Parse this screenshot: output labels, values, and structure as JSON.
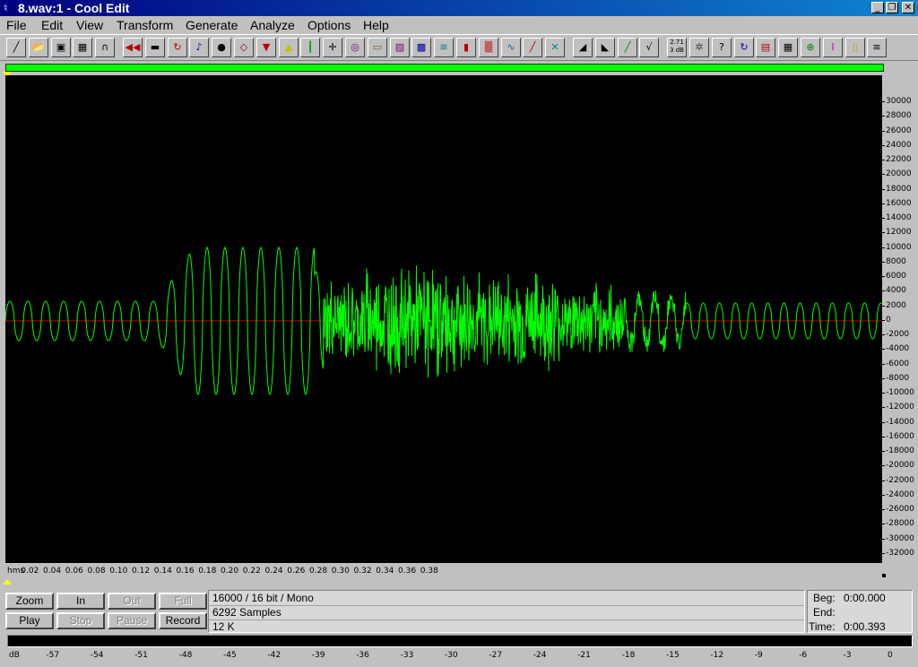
{
  "window": {
    "title": "8.wav:1 - Cool Edit",
    "app_icon": "cool-edit-icon",
    "minimize_label": "_",
    "restore_label": "❐",
    "close_label": "✕"
  },
  "menu": [
    {
      "label": "File"
    },
    {
      "label": "Edit"
    },
    {
      "label": "View"
    },
    {
      "label": "Transform"
    },
    {
      "label": "Generate"
    },
    {
      "label": "Analyze"
    },
    {
      "label": "Options"
    },
    {
      "label": "Help"
    }
  ],
  "toolbar": {
    "buttons": [
      {
        "name": "new-icon",
        "glyph": "╱",
        "color": "#000000"
      },
      {
        "name": "open-icon",
        "glyph": "📂",
        "color": "#c08000"
      },
      {
        "name": "save-icon",
        "glyph": "▣",
        "color": "#000000"
      },
      {
        "name": "cd-icon",
        "glyph": "▦",
        "color": "#000000"
      },
      {
        "name": "headphones-icon",
        "glyph": "∩",
        "color": "#000000"
      },
      {
        "name": "rewind-icon",
        "glyph": "◀◀",
        "color": "#c00000"
      },
      {
        "name": "cut-icon",
        "glyph": "▬",
        "color": "#000000"
      },
      {
        "name": "loop-icon",
        "glyph": "↻",
        "color": "#c00000"
      },
      {
        "name": "note-icon",
        "glyph": "♪",
        "color": "#0000c0"
      },
      {
        "name": "record-dot-icon",
        "glyph": "●",
        "color": "#000000"
      },
      {
        "name": "envelope-icon",
        "glyph": "◇",
        "color": "#800000"
      },
      {
        "name": "marker-down-icon",
        "glyph": "▼",
        "color": "#c00000"
      },
      {
        "name": "amplify-icon",
        "glyph": "▲",
        "color": "#c0c000"
      },
      {
        "name": "waveform-icon",
        "glyph": "┃",
        "color": "#00a000"
      },
      {
        "name": "compass-icon",
        "glyph": "✛",
        "color": "#000000"
      },
      {
        "name": "signal-icon",
        "glyph": "◎",
        "color": "#800080"
      },
      {
        "name": "cassette-icon",
        "glyph": "▭",
        "color": "#806000"
      },
      {
        "name": "filter-icon",
        "glyph": "▨",
        "color": "#800080"
      },
      {
        "name": "spectrum-icon",
        "glyph": "▩",
        "color": "#0000a0"
      },
      {
        "name": "wave-multi-icon",
        "glyph": "≋",
        "color": "#008080"
      },
      {
        "name": "bars-icon",
        "glyph": "▮",
        "color": "#c00000"
      },
      {
        "name": "noise-icon",
        "glyph": "▒",
        "color": "#c00000"
      },
      {
        "name": "wave-blue-icon",
        "glyph": "∿",
        "color": "#0060c0"
      },
      {
        "name": "slope-icon",
        "glyph": "╱",
        "color": "#c00000"
      },
      {
        "name": "crossfade-icon",
        "glyph": "✕",
        "color": "#008080"
      },
      {
        "name": "fade-in-icon",
        "glyph": "◢",
        "color": "#000000"
      },
      {
        "name": "fade-out-icon",
        "glyph": "◣",
        "color": "#000000"
      },
      {
        "name": "trend-icon",
        "glyph": "╱",
        "color": "#008000"
      },
      {
        "name": "graph-icon",
        "glyph": "√",
        "color": "#000000"
      },
      {
        "name": "db-icon",
        "glyph": "dB",
        "color": "#000000"
      },
      {
        "name": "gear-icon",
        "glyph": "✲",
        "color": "#404040"
      },
      {
        "name": "help-icon",
        "glyph": "?",
        "color": "#000000"
      },
      {
        "name": "refresh-icon",
        "glyph": "↻",
        "color": "#0000c0"
      },
      {
        "name": "level-meter-icon",
        "glyph": "▤",
        "color": "#c00000"
      },
      {
        "name": "properties-icon",
        "glyph": "▦",
        "color": "#000000"
      },
      {
        "name": "zoom-analyze-icon",
        "glyph": "⊕",
        "color": "#008000"
      },
      {
        "name": "cursor-icon",
        "glyph": "I",
        "color": "#c000c0"
      },
      {
        "name": "notepad-icon",
        "glyph": "▯",
        "color": "#c0a000"
      },
      {
        "name": "info-icon",
        "glyph": "≡",
        "color": "#000000"
      }
    ],
    "db_label": "2.71 3 dB"
  },
  "waveform": {
    "wave_color": "#00ff00",
    "centerline_color": "#c00000",
    "background": "#000000",
    "y_axis_labels": [
      "30000",
      "28000",
      "26000",
      "24000",
      "22000",
      "20000",
      "18000",
      "16000",
      "14000",
      "12000",
      "10000",
      "8000",
      "6000",
      "4000",
      "2000",
      "0",
      "-2000",
      "-4000",
      "-6000",
      "-8000",
      "-10000",
      "-12000",
      "-14000",
      "-16000",
      "-18000",
      "-20000",
      "-22000",
      "-24000",
      "-26000",
      "-28000",
      "-30000",
      "-32000"
    ],
    "x_axis_labels": [
      "hms",
      "0.02",
      "0.04",
      "0.06",
      "0.08",
      "0.10",
      "0.12",
      "0.14",
      "0.16",
      "0.18",
      "0.20",
      "0.22",
      "0.24",
      "0.26",
      "0.28",
      "0.30",
      "0.32",
      "0.34",
      "0.36",
      "0.38"
    ]
  },
  "transport": {
    "zoom": "Zoom",
    "in": "In",
    "out": "Out",
    "full": "Full",
    "play": "Play",
    "stop": "Stop",
    "pause": "Pause",
    "record": "Record"
  },
  "info": {
    "format": "16000 / 16 bit / Mono",
    "samples": "6292 Samples",
    "size": "12 K"
  },
  "time": {
    "beg_label": "Beg:",
    "beg_value": "0:00.000",
    "end_label": "End:",
    "end_value": "",
    "time_label": "Time:",
    "time_value": "0:00.393"
  },
  "level_meter": {
    "labels": [
      "dB",
      "-57",
      "-54",
      "-51",
      "-48",
      "-45",
      "-42",
      "-39",
      "-36",
      "-33",
      "-30",
      "-27",
      "-24",
      "-21",
      "-18",
      "-15",
      "-12",
      "-9",
      "-6",
      "-3",
      "0"
    ]
  }
}
